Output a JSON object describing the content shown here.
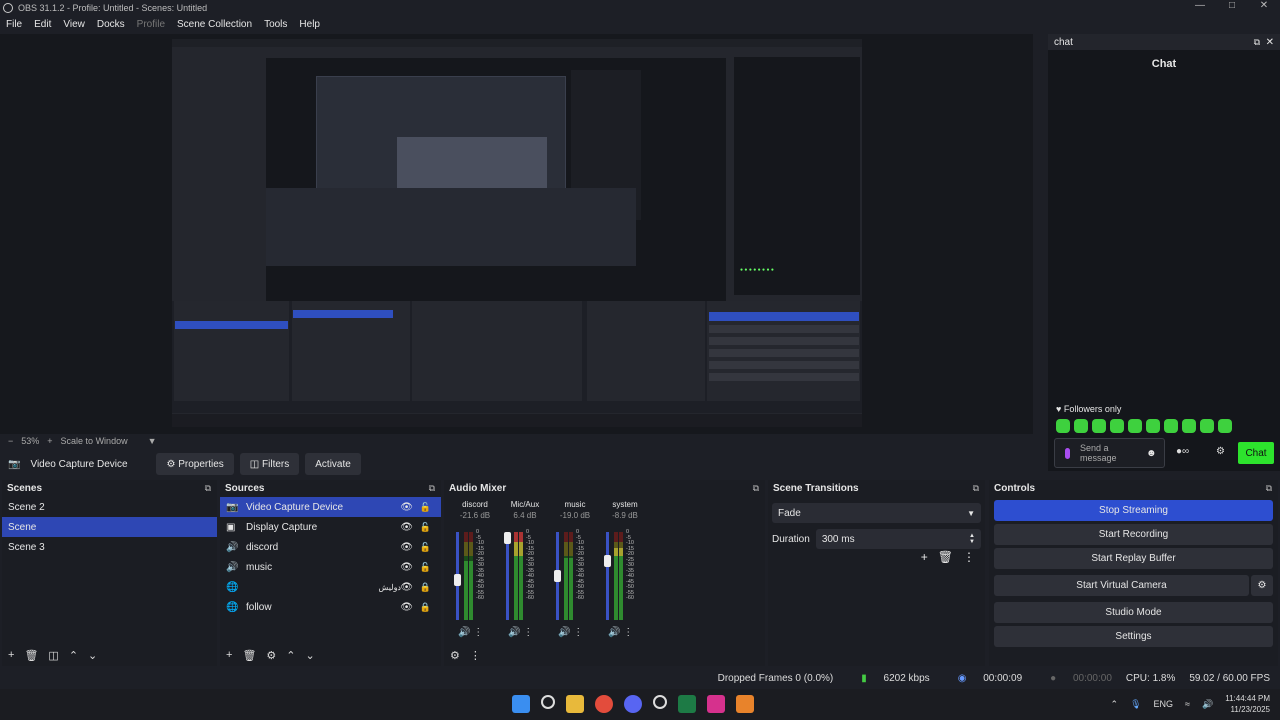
{
  "window": {
    "title": "OBS 31.1.2 - Profile: Untitled - Scenes: Untitled"
  },
  "menu": [
    "File",
    "Edit",
    "View",
    "Docks",
    "Profile",
    "Scene Collection",
    "Tools",
    "Help"
  ],
  "chat_dock": {
    "dock_title": "chat",
    "title": "Chat",
    "followers_only": "Followers only",
    "placeholder": "Send a message",
    "chat_button": "Chat"
  },
  "preview": {
    "zoom": "53%",
    "scale_mode": "Scale to Window"
  },
  "source_bar": {
    "current_source": "Video Capture Device",
    "properties": "Properties",
    "filters": "Filters",
    "activate": "Activate"
  },
  "scenes": {
    "title": "Scenes",
    "items": [
      "Scene 2",
      "Scene",
      "Scene 3"
    ],
    "selected": 1
  },
  "sources": {
    "title": "Sources",
    "items": [
      {
        "label": "Video Capture Device",
        "icon": "camera-icon"
      },
      {
        "label": "Display Capture",
        "icon": "monitor-icon"
      },
      {
        "label": "discord",
        "icon": "speaker-icon"
      },
      {
        "label": "music",
        "icon": "speaker-icon"
      },
      {
        "label": "دوليش",
        "icon": "globe-icon"
      },
      {
        "label": "follow",
        "icon": "globe-icon"
      }
    ]
  },
  "audio_mixer": {
    "title": "Audio Mixer",
    "channels": [
      {
        "name": "discord",
        "db": "-21.6 dB",
        "level": 0.45
      },
      {
        "name": "Mic/Aux",
        "db": "6.4 dB",
        "level": 1.0
      },
      {
        "name": "music",
        "db": "-19.0 dB",
        "level": 0.5
      },
      {
        "name": "system",
        "db": "-8.9 dB",
        "level": 0.7
      }
    ],
    "scale": [
      "0",
      "-5",
      "-10",
      "-15",
      "-20",
      "-25",
      "-30",
      "-35",
      "-40",
      "-45",
      "-50",
      "-55",
      "-60"
    ]
  },
  "transitions": {
    "title": "Scene Transitions",
    "selected": "Fade",
    "duration_label": "Duration",
    "duration": "300 ms"
  },
  "controls": {
    "title": "Controls",
    "buttons": [
      "Stop Streaming",
      "Start Recording",
      "Start Replay Buffer",
      "Start Virtual Camera",
      "Studio Mode",
      "Settings"
    ]
  },
  "status": {
    "dropped": "Dropped Frames 0 (0.0%)",
    "bitrate": "6202 kbps",
    "stream_time": "00:00:09",
    "rec_time": "00:00:00",
    "cpu": "CPU: 1.8%",
    "fps": "59.02 / 60.00 FPS"
  },
  "taskbar": {
    "lang": "ENG",
    "time": "11:44:44 PM",
    "date": "11/23/2025"
  }
}
